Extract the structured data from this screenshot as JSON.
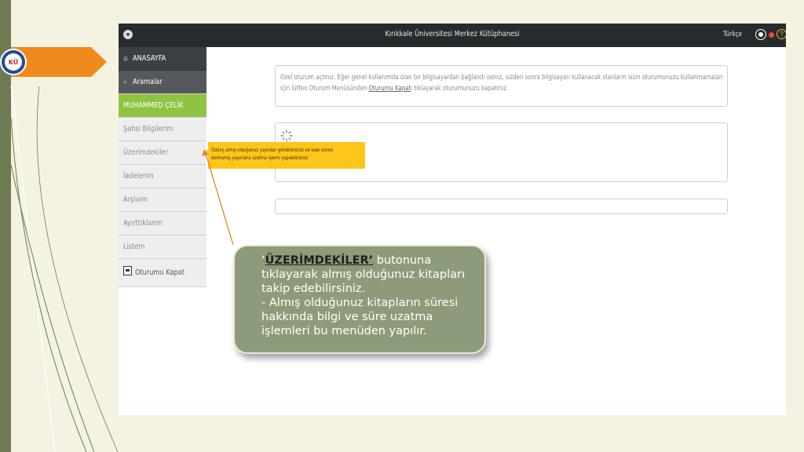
{
  "app": {
    "title": "Kırıkkale Üniversitesi Merkez Kütüphanesi",
    "language": "Türkçe",
    "help_glyph": "?"
  },
  "logo": {
    "text": "KÜ"
  },
  "sidebar": {
    "items": [
      {
        "label": "ANASAYFA",
        "icon": "home-icon",
        "style": "dark"
      },
      {
        "label": "Aramalar",
        "icon": "search-icon",
        "style": "darker"
      },
      {
        "label": "MUHAMMED ÇELİK",
        "style": "green"
      },
      {
        "label": "Şahsi Bilgilerim"
      },
      {
        "label": "Üzerimdekiler"
      },
      {
        "label": "İadelerim"
      },
      {
        "label": "Arşivim"
      },
      {
        "label": "Ayırttıklarım"
      },
      {
        "label": "Listem"
      },
      {
        "label": "Oturumu Kapat",
        "icon": "logout-icon"
      }
    ]
  },
  "main": {
    "notice_line1": "Özel oturum açtınız. Eğer genel kullanımda olan bir bilgisayardan bağlandı iseniz, sizden sonra bilgisayarı kullanacak olanların sizin oturumunuzu kullanmamaları",
    "notice_line2_pre": "için lütfen Oturum Menüsünden ",
    "notice_link": "Oturumu Kapat",
    "notice_line2_post": "ı tıklayarak oturumunuzu kapatınız."
  },
  "tooltip": {
    "line1": "Ödünç almış olduğunuz yayınları görebilirsiniz ve iade süresi",
    "line2": "dolmamış yayınlara uzatma işlemi yapabilirsiniz."
  },
  "callout": {
    "quote_open": "‘",
    "highlight": "ÜZERİMDEKİLER’",
    "text1": " butonuna tıklayarak almış olduğunuz kitapları takip edebilirsiniz.",
    "text2": "- Almış olduğunuz kitapların süresi hakkında bilgi ve süre uzatma işlemleri bu menüden yapılır."
  },
  "colors": {
    "topbar": "#272b2d",
    "active_user": "#8fc442",
    "tooltip": "#ffc51b",
    "callout": "#8e9b7a",
    "accent_arrow": "#f08a1c"
  }
}
